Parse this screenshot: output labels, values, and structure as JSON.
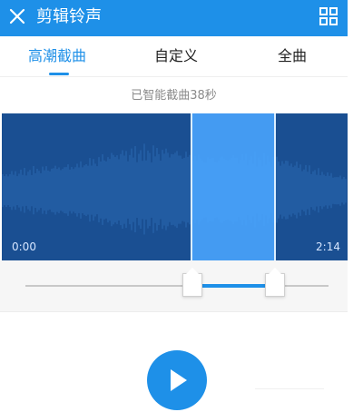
{
  "header": {
    "title": "剪辑铃声",
    "close_icon": "close-icon",
    "menu_icon": "grid-icon",
    "color": "#1e90e8"
  },
  "tabs": [
    {
      "label": "高潮截曲",
      "active": true
    },
    {
      "label": "自定义",
      "active": false
    },
    {
      "label": "全曲",
      "active": false
    }
  ],
  "status_text": "已智能截曲38秒",
  "waveform": {
    "start_time": "0:00",
    "end_time": "2:14",
    "selection_start_fraction": 0.55,
    "selection_end_fraction": 0.79
  },
  "slider": {
    "left_value_fraction": 0.55,
    "right_value_fraction": 0.79
  },
  "controls": {
    "play_icon": "play-icon"
  }
}
